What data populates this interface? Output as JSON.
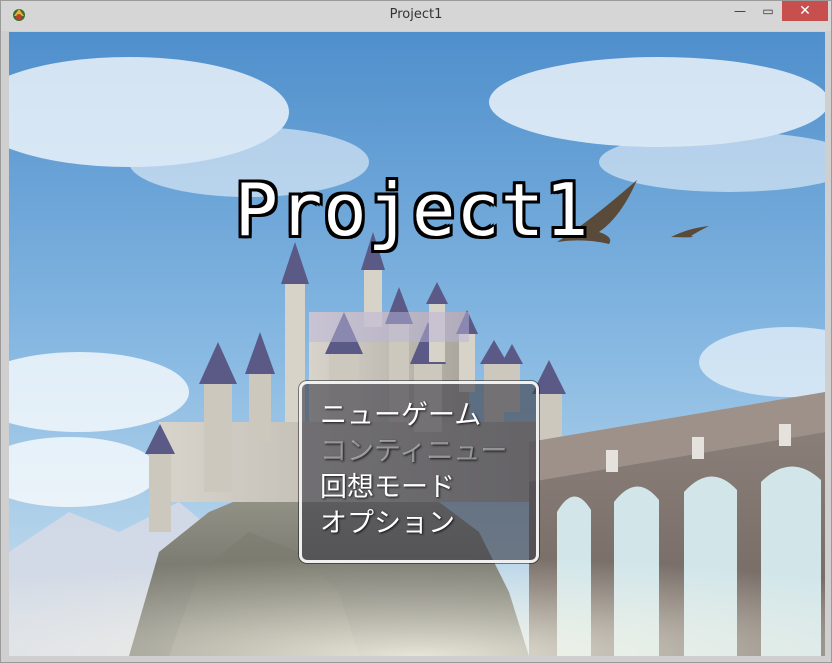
{
  "window": {
    "title": "Project1",
    "close_glyph": "✕",
    "minimize_glyph": "—",
    "maximize_glyph": "▭",
    "icon": "rpg-maker-app-icon"
  },
  "game": {
    "title": "Project1"
  },
  "menu": {
    "items": [
      {
        "label": "ニューゲーム",
        "state": "selected"
      },
      {
        "label": "コンティニュー",
        "state": "disabled"
      },
      {
        "label": "回想モード",
        "state": "enabled"
      },
      {
        "label": "オプション",
        "state": "enabled"
      }
    ]
  },
  "colors": {
    "menu_highlight": "#a0dcbe",
    "close_button": "#c7504f",
    "sky": "#6aa2d8"
  }
}
